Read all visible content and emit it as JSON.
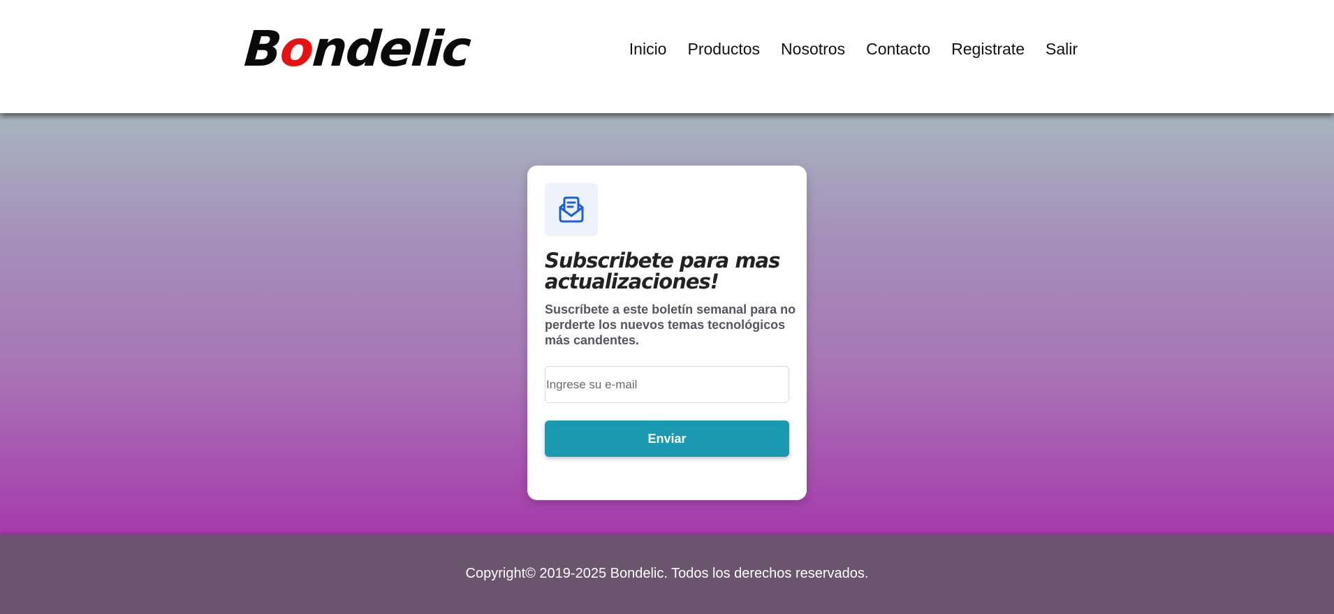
{
  "header": {
    "logo_text_first": "B",
    "logo_text_accent": "o",
    "logo_text_rest": "ndelic",
    "nav": [
      {
        "label": "Inicio"
      },
      {
        "label": "Productos"
      },
      {
        "label": "Nosotros"
      },
      {
        "label": "Contacto"
      },
      {
        "label": "Registrate"
      },
      {
        "label": "Salir"
      }
    ]
  },
  "card": {
    "icon": "envelope-open-icon",
    "title": "Subscribete para mas actualizaciones!",
    "description": "Suscríbete a este boletín semanal para no perderte los nuevos temas tecnológicos más candentes.",
    "email_placeholder": "Ingrese su e-mail",
    "button_label": "Enviar"
  },
  "footer": {
    "copyright": "Copyright© 2019-2025 Bondelic. Todos los derechos reservados."
  },
  "colors": {
    "accent_red": "#e81010",
    "button": "#1a99b0",
    "footer_bg": "#6b546d",
    "icon_blue": "#1a5fe0"
  }
}
